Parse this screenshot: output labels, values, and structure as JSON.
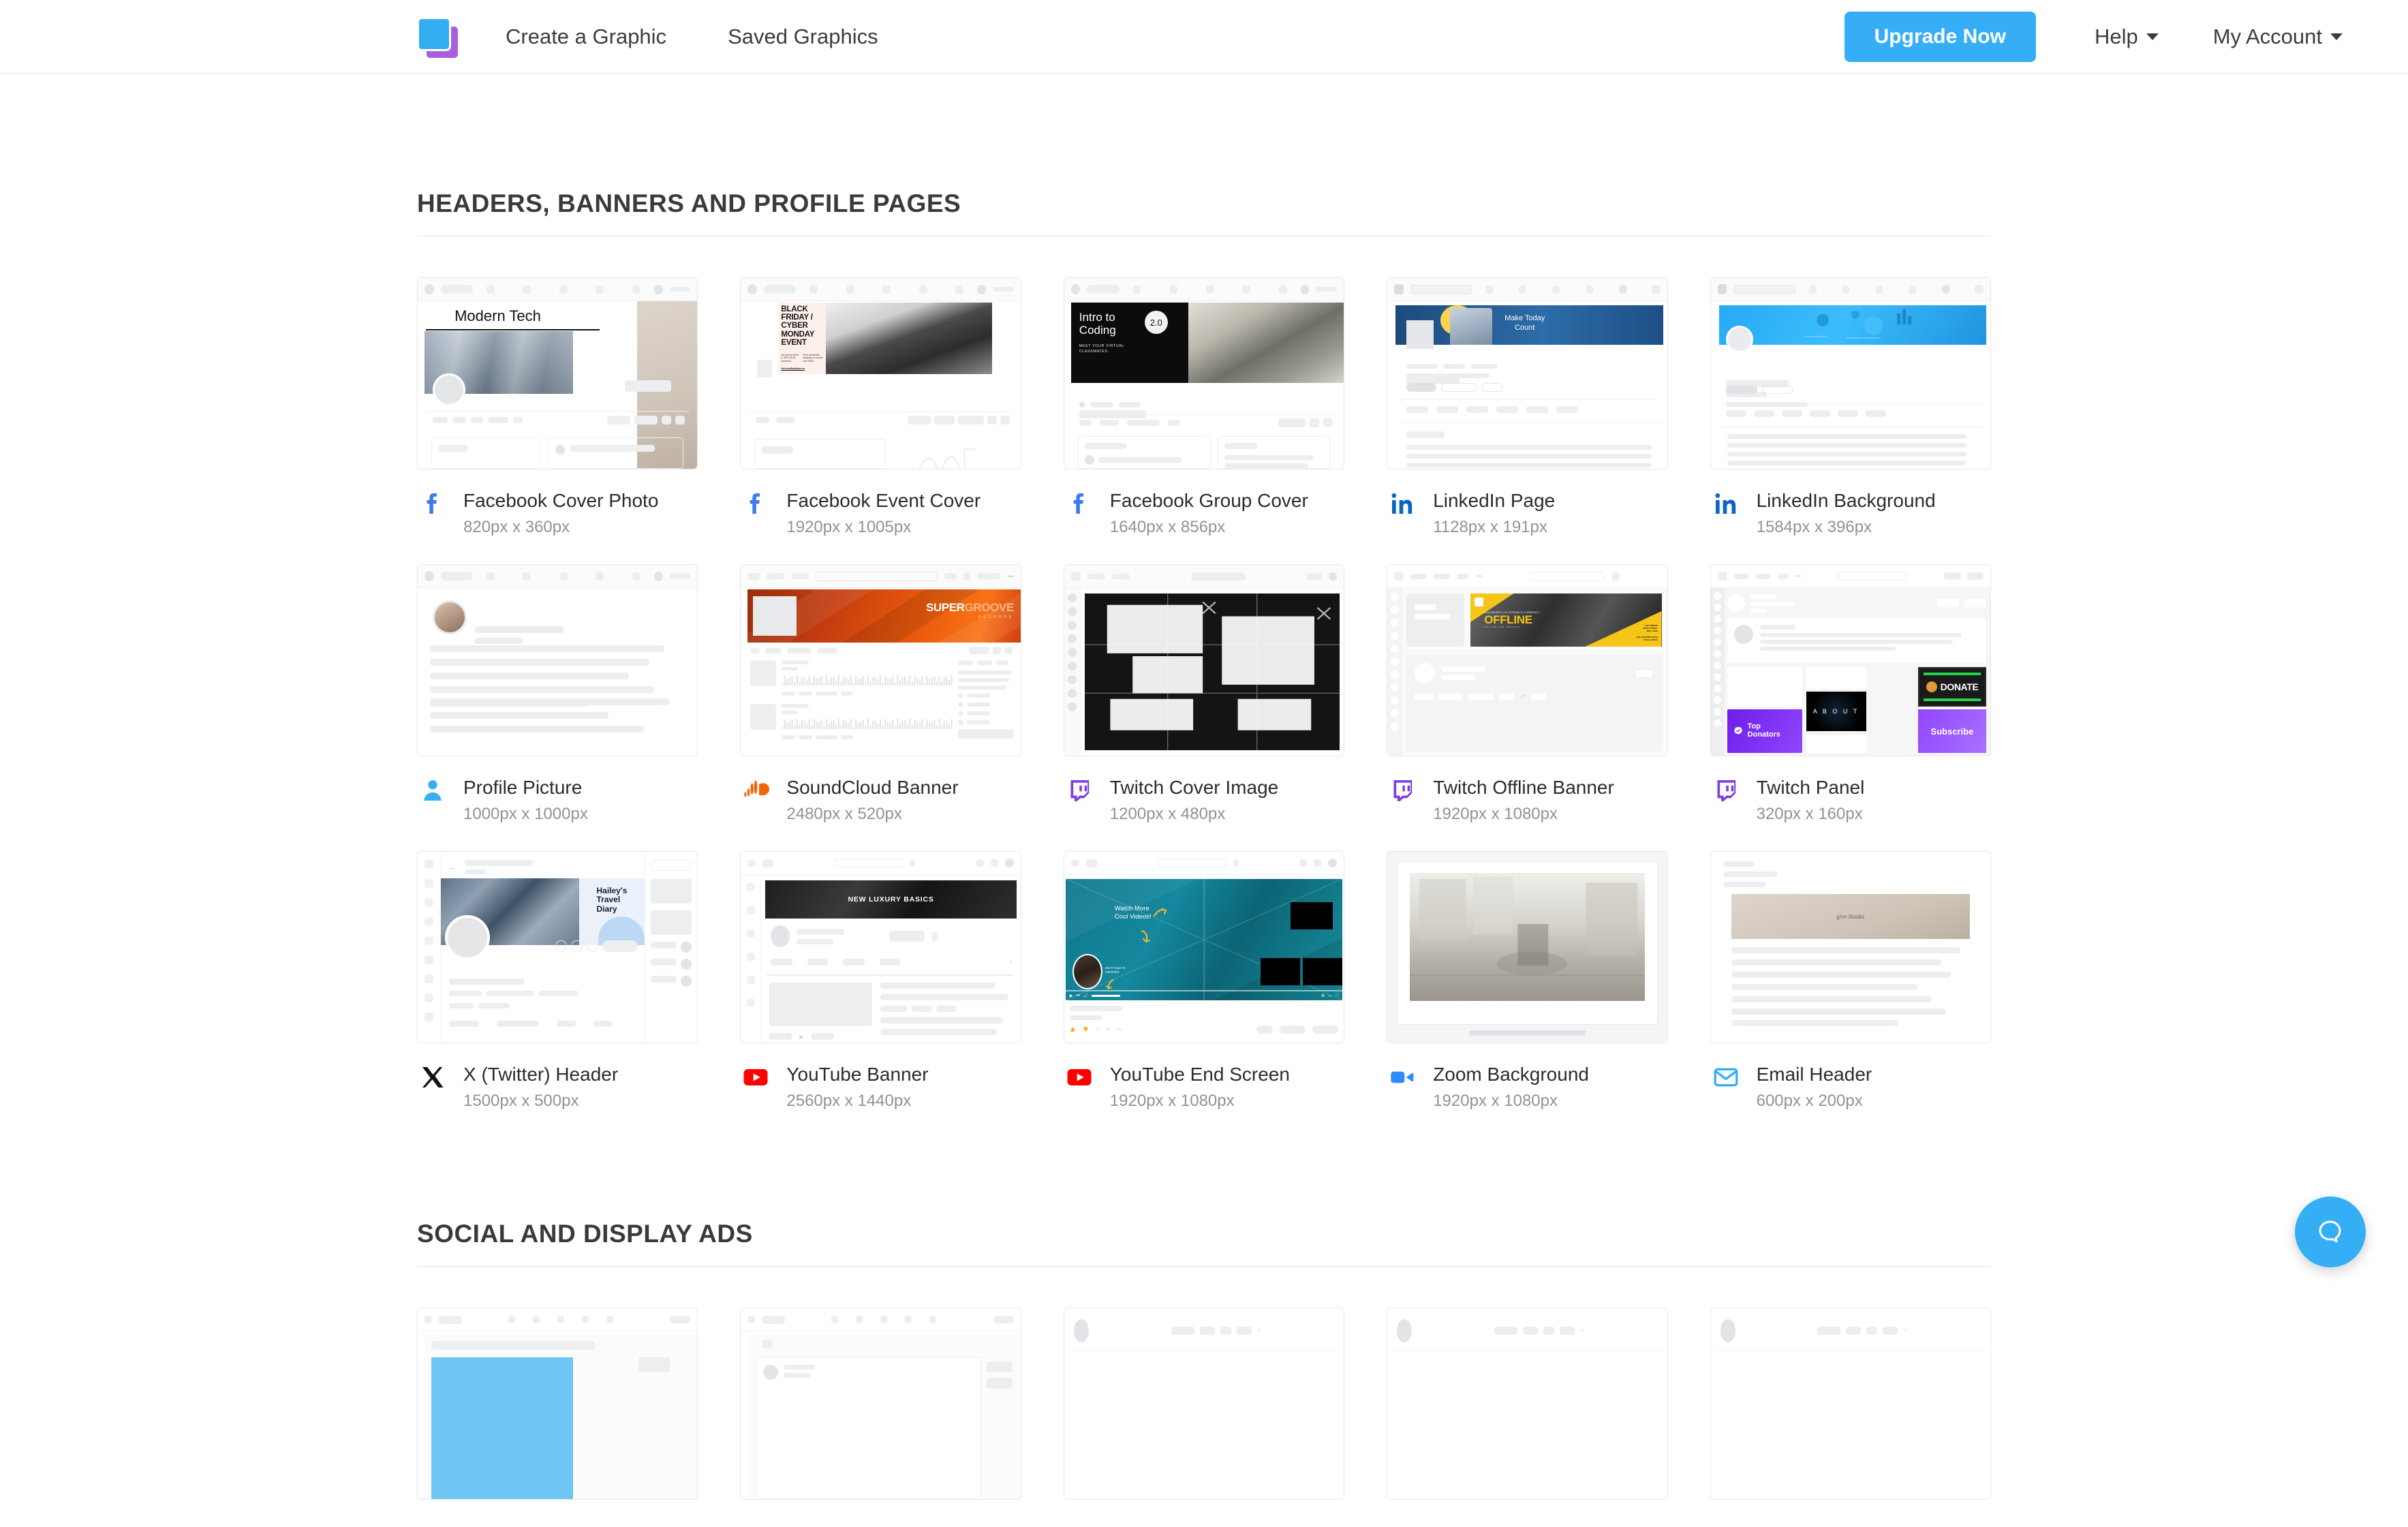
{
  "nav": {
    "logo_name": "app-logo",
    "links": [
      {
        "label": "Create a Graphic"
      },
      {
        "label": "Saved Graphics"
      }
    ],
    "upgrade_label": "Upgrade Now",
    "help_label": "Help",
    "account_label": "My Account",
    "accent_color": "#35aef5"
  },
  "sections": [
    {
      "title": "HEADERS, BANNERS AND PROFILE PAGES",
      "cards": [
        {
          "title": "Facebook Cover Photo",
          "dims": "820px x 360px",
          "icon": "facebook-icon",
          "icon_color": "#3b7bec",
          "mock": "fb-cover",
          "art_text": "Modern Tech"
        },
        {
          "title": "Facebook Event Cover",
          "dims": "1920px x 1005px",
          "icon": "facebook-icon",
          "icon_color": "#3b7bec",
          "mock": "fb-event",
          "art_text": "BLACK FRIDAY / CYBER MONDAY EVENT"
        },
        {
          "title": "Facebook Group Cover",
          "dims": "1640px x 856px",
          "icon": "facebook-icon",
          "icon_color": "#3b7bec",
          "mock": "fb-group",
          "art_text": "Intro to Coding 2.0 — MEET YOUR VIRTUAL CLASSMATES."
        },
        {
          "title": "LinkedIn Page",
          "dims": "1128px x 191px",
          "icon": "linkedin-icon",
          "icon_color": "#0a66c2",
          "mock": "li-page",
          "art_text": "Make Today Count"
        },
        {
          "title": "LinkedIn Background",
          "dims": "1584px x 396px",
          "icon": "linkedin-icon",
          "icon_color": "#0a66c2",
          "mock": "li-bg",
          "art_text": ""
        },
        {
          "title": "Profile Picture",
          "dims": "1000px x 1000px",
          "icon": "person-icon",
          "icon_color": "#35aef5",
          "mock": "profile-pic",
          "art_text": ""
        },
        {
          "title": "SoundCloud Banner",
          "dims": "2480px x 520px",
          "icon": "soundcloud-icon",
          "icon_color": "#f2630a",
          "mock": "sc-banner",
          "art_text": "SUPER GROOVE RECORDS"
        },
        {
          "title": "Twitch Cover Image",
          "dims": "1200px x 480px",
          "icon": "twitch-icon",
          "icon_color": "#7d3ce4",
          "mock": "tw-cover",
          "art_text": ""
        },
        {
          "title": "Twitch Offline Banner",
          "dims": "1920px x 1080px",
          "icon": "twitch-icon",
          "icon_color": "#7d3ce4",
          "mock": "tw-offline",
          "art_text": "OFFLINE"
        },
        {
          "title": "Twitch Panel",
          "dims": "320px x 160px",
          "icon": "twitch-icon",
          "icon_color": "#7d3ce4",
          "mock": "tw-panel",
          "art_text": "DONATE / ABOUT / Top Donators / Subscribe"
        },
        {
          "title": "X (Twitter) Header",
          "dims": "1500px x 500px",
          "icon": "x-icon",
          "icon_color": "#111111",
          "mock": "x-header",
          "art_text": "Hailey's Travel Diary"
        },
        {
          "title": "YouTube Banner",
          "dims": "2560px x 1440px",
          "icon": "youtube-icon",
          "icon_color": "#ff0000",
          "mock": "yt-banner",
          "art_text": "NEW LUXURY BASICS"
        },
        {
          "title": "YouTube End Screen",
          "dims": "1920px x 1080px",
          "icon": "youtube-icon",
          "icon_color": "#ff0000",
          "mock": "yt-end",
          "art_text": "Watch More Cool Videos! / Don't Forget To Subscribe!"
        },
        {
          "title": "Zoom Background",
          "dims": "1920px x 1080px",
          "icon": "zoom-icon",
          "icon_color": "#2d8cff",
          "mock": "zoom-bg",
          "art_text": ""
        },
        {
          "title": "Email Header",
          "dims": "600px x 200px",
          "icon": "email-icon",
          "icon_color": "#35aef5",
          "mock": "email-hdr",
          "art_text": "give thanks"
        }
      ]
    },
    {
      "title": "SOCIAL AND DISPLAY ADS",
      "cards": [
        {
          "title": "",
          "dims": "",
          "icon": "",
          "icon_color": "",
          "mock": "ad-1",
          "art_text": ""
        },
        {
          "title": "",
          "dims": "",
          "icon": "",
          "icon_color": "",
          "mock": "ad-2",
          "art_text": ""
        },
        {
          "title": "",
          "dims": "",
          "icon": "",
          "icon_color": "",
          "mock": "ad-3",
          "art_text": ""
        },
        {
          "title": "",
          "dims": "",
          "icon": "",
          "icon_color": "",
          "mock": "ad-4",
          "art_text": ""
        },
        {
          "title": "",
          "dims": "",
          "icon": "",
          "icon_color": "",
          "mock": "ad-5",
          "art_text": ""
        }
      ]
    }
  ],
  "mock_art": {
    "fb_cover_title": "Modern Tech",
    "fb_event_lines": [
      "BLACK",
      "FRIDAY /",
      "CYBER",
      "MONDAY",
      "EVENT"
    ],
    "fb_event_sub1": "All current stock is 30% off all weekend",
    "fb_event_sub2": "Free worldwide shipping on orders over $100",
    "fb_event_link": "theLuxeBoutique.co",
    "fb_group_title1": "Intro to",
    "fb_group_title2": "Coding",
    "fb_group_badge": "2.0",
    "fb_group_sub": "MEET YOUR VIRTUAL CLASSMATES.",
    "li_page_title1": "Make Today",
    "li_page_title2": "Count",
    "sc_title1": "SUPER",
    "sc_title2": "GROOVE",
    "sc_sub": "RECORDS",
    "tw_offline_top": "BLACKBURN'S CHI STREAM IS CURRENTLY",
    "tw_offline_title": "OFFLINE",
    "tw_panel_donate": "DONATE",
    "tw_panel_about": "A B O U T",
    "tw_panel_top1": "Top",
    "tw_panel_top2": "Donators",
    "tw_panel_sub": "Subscribe",
    "x_title1": "Hailey's",
    "x_title2": "Travel",
    "x_title3": "Diary",
    "yt_banner_title": "NEW LUXURY BASICS",
    "yt_end_title1": "Watch More",
    "yt_end_title2": "Cool Videos!",
    "yt_end_sub1": "Don't Forget To",
    "yt_end_sub2": "Subscribe!",
    "email_title": "give thanks"
  },
  "help_widget": {
    "name": "help-chat-button",
    "color": "#35aef5"
  }
}
